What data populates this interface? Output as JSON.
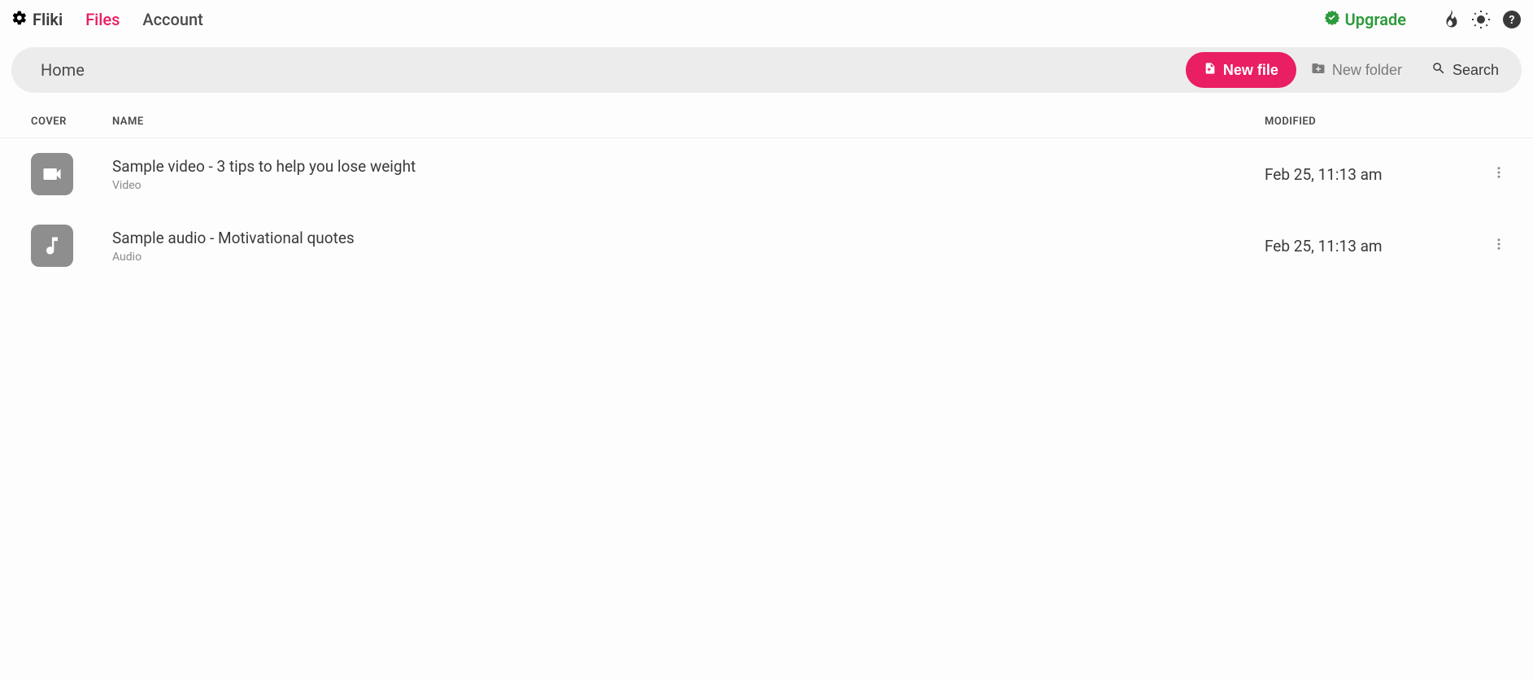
{
  "brand": "Fliki",
  "nav": {
    "files": "Files",
    "account": "Account"
  },
  "upgrade_label": "Upgrade",
  "toolbar": {
    "breadcrumb": "Home",
    "new_file": "New file",
    "new_folder": "New folder",
    "search": "Search"
  },
  "columns": {
    "cover": "COVER",
    "name": "NAME",
    "modified": "MODIFIED"
  },
  "files": [
    {
      "title": "Sample video - 3 tips to help you lose weight",
      "type": "Video",
      "modified": "Feb 25, 11:13 am",
      "icon": "video"
    },
    {
      "title": "Sample audio - Motivational quotes",
      "type": "Audio",
      "modified": "Feb 25, 11:13 am",
      "icon": "audio"
    }
  ]
}
